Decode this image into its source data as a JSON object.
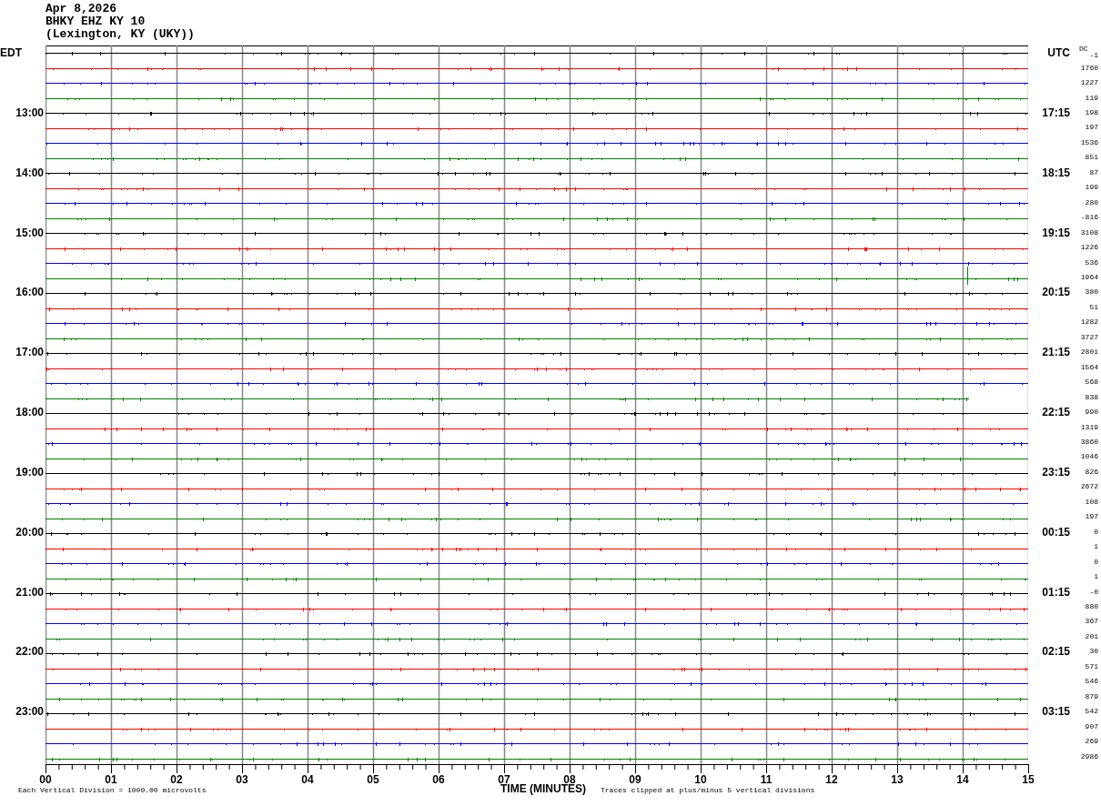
{
  "header": [
    "Apr 8,2026",
    "BHKY EHZ KY 10",
    "(Lexington, KY (UKY))"
  ],
  "left_zone": "EDT",
  "right_zone": "UTC",
  "dc_label": "DC",
  "rows": [
    {
      "left": "",
      "right": "",
      "value": "-1",
      "color": "#000000"
    },
    {
      "left": "",
      "right": "",
      "value": "1760",
      "color": "#ff0000"
    },
    {
      "left": "",
      "right": "",
      "value": "1227",
      "color": "#0000ff"
    },
    {
      "left": "",
      "right": "",
      "value": "119",
      "color": "#008000"
    },
    {
      "left": "13:00",
      "right": "17:15",
      "value": "198",
      "color": "#000000"
    },
    {
      "left": "",
      "right": "",
      "value": "197",
      "color": "#ff0000"
    },
    {
      "left": "",
      "right": "",
      "value": "1536",
      "color": "#0000ff"
    },
    {
      "left": "",
      "right": "",
      "value": "851",
      "color": "#008000"
    },
    {
      "left": "14:00",
      "right": "18:15",
      "value": "87",
      "color": "#000000"
    },
    {
      "left": "",
      "right": "",
      "value": "199",
      "color": "#ff0000"
    },
    {
      "left": "",
      "right": "",
      "value": "280",
      "color": "#0000ff"
    },
    {
      "left": "",
      "right": "",
      "value": "-816",
      "color": "#008000"
    },
    {
      "left": "15:00",
      "right": "19:15",
      "value": "3108",
      "color": "#000000"
    },
    {
      "left": "",
      "right": "",
      "value": "1226",
      "color": "#ff0000"
    },
    {
      "left": "",
      "right": "",
      "value": "536",
      "color": "#0000ff"
    },
    {
      "left": "",
      "right": "",
      "value": "1964",
      "color": "#008000"
    },
    {
      "left": "16:00",
      "right": "20:15",
      "value": "380",
      "color": "#000000"
    },
    {
      "left": "",
      "right": "",
      "value": "51",
      "color": "#ff0000"
    },
    {
      "left": "",
      "right": "",
      "value": "1282",
      "color": "#0000ff"
    },
    {
      "left": "",
      "right": "",
      "value": "3727",
      "color": "#008000"
    },
    {
      "left": "17:00",
      "right": "21:15",
      "value": "2801",
      "color": "#000000"
    },
    {
      "left": "",
      "right": "",
      "value": "1564",
      "color": "#ff0000"
    },
    {
      "left": "",
      "right": "",
      "value": "568",
      "color": "#0000ff"
    },
    {
      "left": "",
      "right": "",
      "value": "838",
      "color": "#008000"
    },
    {
      "left": "18:00",
      "right": "22:15",
      "value": "990",
      "color": "#000000"
    },
    {
      "left": "",
      "right": "",
      "value": "1319",
      "color": "#ff0000"
    },
    {
      "left": "",
      "right": "",
      "value": "3860",
      "color": "#0000ff"
    },
    {
      "left": "",
      "right": "",
      "value": "1046",
      "color": "#008000"
    },
    {
      "left": "19:00",
      "right": "23:15",
      "value": "826",
      "color": "#000000"
    },
    {
      "left": "",
      "right": "",
      "value": "2672",
      "color": "#ff0000"
    },
    {
      "left": "",
      "right": "",
      "value": "108",
      "color": "#0000ff"
    },
    {
      "left": "",
      "right": "",
      "value": "197",
      "color": "#008000"
    },
    {
      "left": "20:00",
      "right": "00:15",
      "value": "0",
      "color": "#000000"
    },
    {
      "left": "",
      "right": "",
      "value": "1",
      "color": "#ff0000"
    },
    {
      "left": "",
      "right": "",
      "value": "0",
      "color": "#0000ff"
    },
    {
      "left": "",
      "right": "",
      "value": "1",
      "color": "#008000"
    },
    {
      "left": "21:00",
      "right": "01:15",
      "value": "-0",
      "color": "#000000"
    },
    {
      "left": "",
      "right": "",
      "value": "880",
      "color": "#ff0000"
    },
    {
      "left": "",
      "right": "",
      "value": "367",
      "color": "#0000ff"
    },
    {
      "left": "",
      "right": "",
      "value": "201",
      "color": "#008000"
    },
    {
      "left": "22:00",
      "right": "02:15",
      "value": "30",
      "color": "#000000"
    },
    {
      "left": "",
      "right": "",
      "value": "571",
      "color": "#ff0000"
    },
    {
      "left": "",
      "right": "",
      "value": "546",
      "color": "#0000ff"
    },
    {
      "left": "",
      "right": "",
      "value": "879",
      "color": "#008000"
    },
    {
      "left": "23:00",
      "right": "03:15",
      "value": "542",
      "color": "#000000"
    },
    {
      "left": "",
      "right": "",
      "value": "907",
      "color": "#ff0000"
    },
    {
      "left": "",
      "right": "",
      "value": "269",
      "color": "#0000ff"
    },
    {
      "left": "",
      "right": "",
      "value": "2986",
      "color": "#008000"
    }
  ],
  "x_ticks": [
    "00",
    "01",
    "02",
    "03",
    "04",
    "05",
    "06",
    "07",
    "08",
    "09",
    "10",
    "11",
    "12",
    "13",
    "14",
    "15"
  ],
  "footer": {
    "scale_note": "Each Vertical Division = 1000.00 microvolts",
    "axis_title": "TIME (MINUTES)",
    "clip_note": "Traces clipped at plus/minus 5 vertical divisions"
  }
}
